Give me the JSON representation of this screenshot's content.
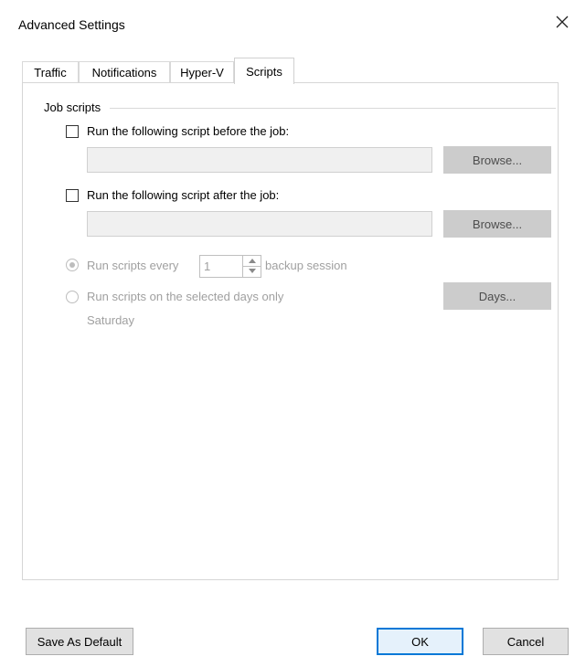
{
  "window": {
    "title": "Advanced Settings"
  },
  "tabs": [
    {
      "label": "Traffic",
      "active": false
    },
    {
      "label": "Notifications",
      "active": false
    },
    {
      "label": "Hyper-V",
      "active": false
    },
    {
      "label": "Scripts",
      "active": true
    }
  ],
  "job_scripts": {
    "group_label": "Job scripts",
    "before": {
      "label": "Run the following script before the job:",
      "checked": false,
      "value": "",
      "browse_label": "Browse..."
    },
    "after": {
      "label": "Run the following script after the job:",
      "checked": false,
      "value": "",
      "browse_label": "Browse..."
    },
    "run_every": {
      "label": "Run scripts every",
      "value": "1",
      "suffix": "backup session",
      "selected": true,
      "enabled": false
    },
    "selected_days": {
      "label": "Run scripts on the selected days only",
      "days_button": "Days...",
      "days_value": "Saturday",
      "selected": false,
      "enabled": false
    }
  },
  "footer": {
    "save_default_label": "Save As Default",
    "ok_label": "OK",
    "cancel_label": "Cancel"
  },
  "colors": {
    "accent": "#0078d7",
    "disabled_button": "#cccccc",
    "field_bg": "#f0f0f0",
    "disabled_text": "#a0a0a0"
  },
  "icons": {
    "close": "close-icon",
    "spin_up": "chevron-up-icon",
    "spin_down": "chevron-down-icon"
  }
}
